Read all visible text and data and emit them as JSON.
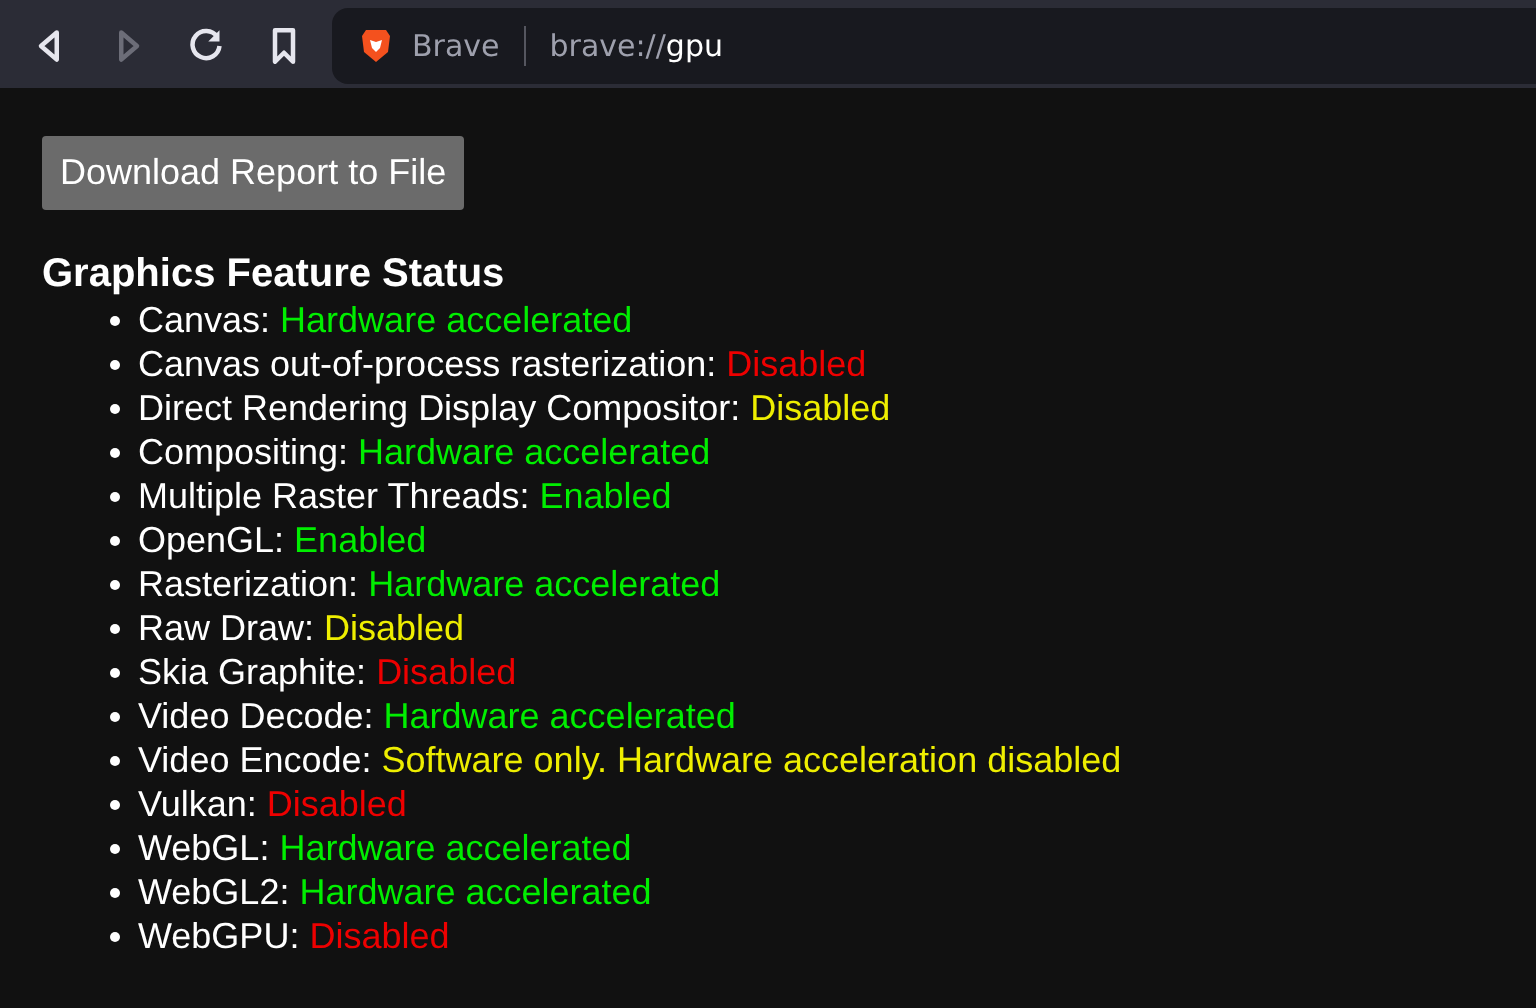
{
  "toolbar": {
    "buttons": [
      {
        "kind": "back",
        "disabled": false
      },
      {
        "kind": "forward",
        "disabled": true
      },
      {
        "kind": "reload",
        "disabled": false
      },
      {
        "kind": "bookmark",
        "disabled": false
      }
    ]
  },
  "address_bar": {
    "site_label": "Brave",
    "url_scheme": "brave://",
    "url_host": "gpu"
  },
  "download_button": "Download Report to File",
  "heading": "Graphics Feature Status",
  "features": [
    {
      "name": "Canvas:",
      "status": "Hardware accelerated",
      "color": "#00ee00"
    },
    {
      "name": "Canvas out-of-process rasterization:",
      "status": "Disabled",
      "color": "#ee0000"
    },
    {
      "name": "Direct Rendering Display Compositor:",
      "status": "Disabled",
      "color": "#eeee00"
    },
    {
      "name": "Compositing:",
      "status": "Hardware accelerated",
      "color": "#00ee00"
    },
    {
      "name": "Multiple Raster Threads:",
      "status": "Enabled",
      "color": "#00ee00"
    },
    {
      "name": "OpenGL:",
      "status": "Enabled",
      "color": "#00ee00"
    },
    {
      "name": "Rasterization:",
      "status": "Hardware accelerated",
      "color": "#00ee00"
    },
    {
      "name": "Raw Draw:",
      "status": "Disabled",
      "color": "#eeee00"
    },
    {
      "name": "Skia Graphite:",
      "status": "Disabled",
      "color": "#ee0000"
    },
    {
      "name": "Video Decode:",
      "status": "Hardware accelerated",
      "color": "#00ee00"
    },
    {
      "name": "Video Encode:",
      "status": "Software only. Hardware acceleration disabled",
      "color": "#eeee00"
    },
    {
      "name": "Vulkan:",
      "status": "Disabled",
      "color": "#ee0000"
    },
    {
      "name": "WebGL:",
      "status": "Hardware accelerated",
      "color": "#00ee00"
    },
    {
      "name": "WebGL2:",
      "status": "Hardware accelerated",
      "color": "#00ee00"
    },
    {
      "name": "WebGPU:",
      "status": "Disabled",
      "color": "#ee0000"
    }
  ]
}
